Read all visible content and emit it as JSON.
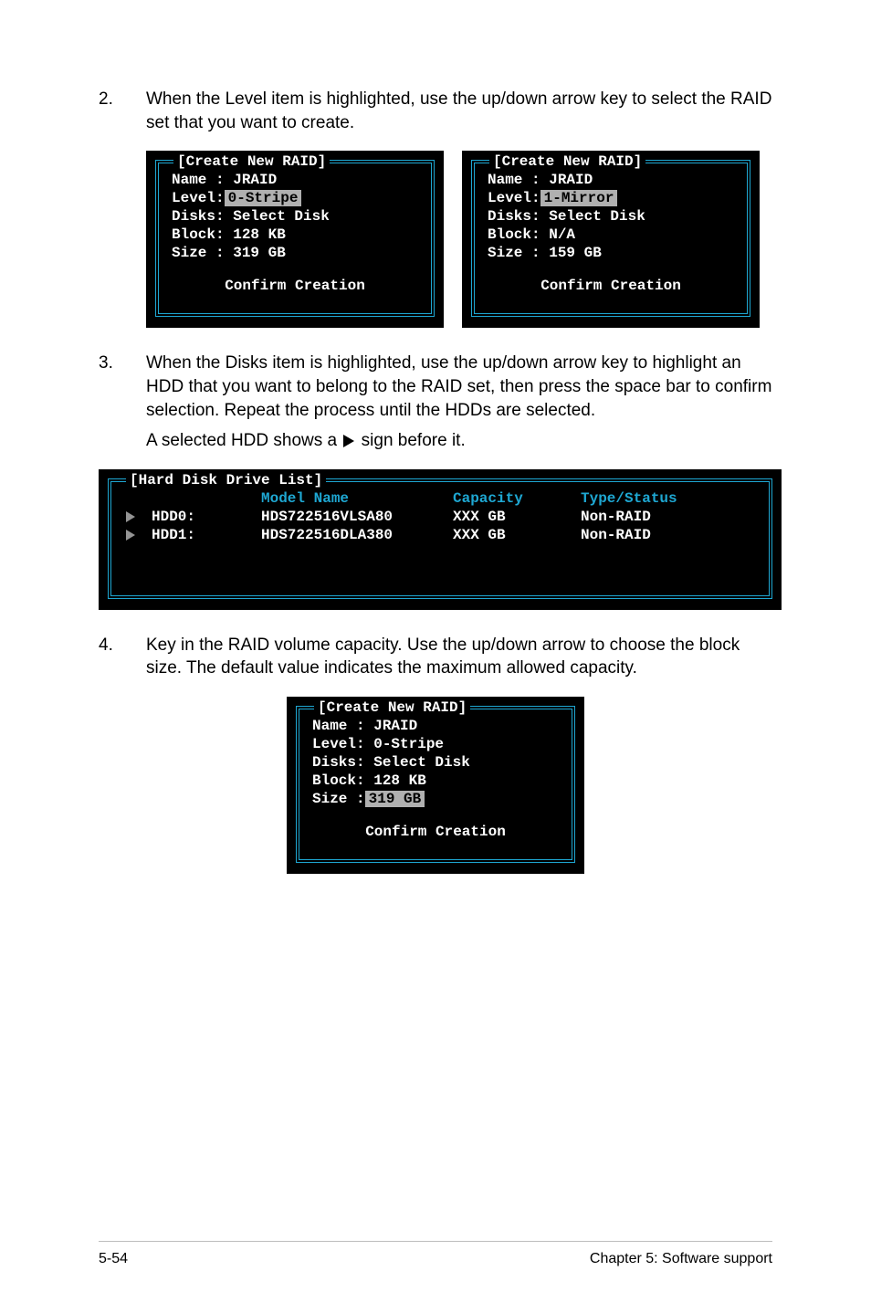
{
  "steps": {
    "s2": {
      "num": "2.",
      "text": "When the Level item is highlighted, use the up/down arrow key to select the RAID set that you want to create."
    },
    "s3": {
      "num": "3.",
      "text": "When the Disks item is highlighted, use the up/down arrow key to highlight an HDD that you want to belong to the RAID set, then press the space bar to confirm selection. Repeat the process until the HDDs are selected.",
      "sub_before": "A selected HDD shows a",
      "sub_after": "sign before it."
    },
    "s4": {
      "num": "4.",
      "text": "Key in the RAID volume capacity. Use the up/down arrow to choose the block size. The default value indicates the maximum allowed capacity."
    }
  },
  "panelA": {
    "title": "[Create New RAID]",
    "name": "Name : JRAID",
    "level_label": "Level:",
    "level_value": "0-Stripe",
    "disks": "Disks: Select Disk",
    "block": "Block: 128 KB",
    "size": "Size : 319 GB",
    "confirm": "Confirm Creation"
  },
  "panelB": {
    "title": "[Create New RAID]",
    "name": "Name : JRAID",
    "level_label": "Level:",
    "level_value": "1-Mirror",
    "disks": "Disks: Select Disk",
    "block": "Block: N/A",
    "size": "Size : 159 GB",
    "confirm": "Confirm Creation"
  },
  "driveList": {
    "title": "[Hard Disk Drive List]",
    "headers": {
      "model": "Model Name",
      "capacity": "Capacity",
      "type": "Type/Status"
    },
    "rows": [
      {
        "id": "HDD0:",
        "model": "HDS722516VLSA80",
        "cap": "XXX GB",
        "type": "Non-RAID"
      },
      {
        "id": "HDD1:",
        "model": "HDS722516DLA380",
        "cap": "XXX GB",
        "type": "Non-RAID"
      }
    ]
  },
  "panelC": {
    "title": "[Create New RAID]",
    "name": "Name : JRAID",
    "level": "Level: 0-Stripe",
    "disks": "Disks: Select Disk",
    "block": "Block: 128 KB",
    "size_label": "Size :",
    "size_value": "319 GB",
    "confirm": "Confirm Creation"
  },
  "footer": {
    "left": "5-54",
    "right": "Chapter 5: Software support"
  }
}
